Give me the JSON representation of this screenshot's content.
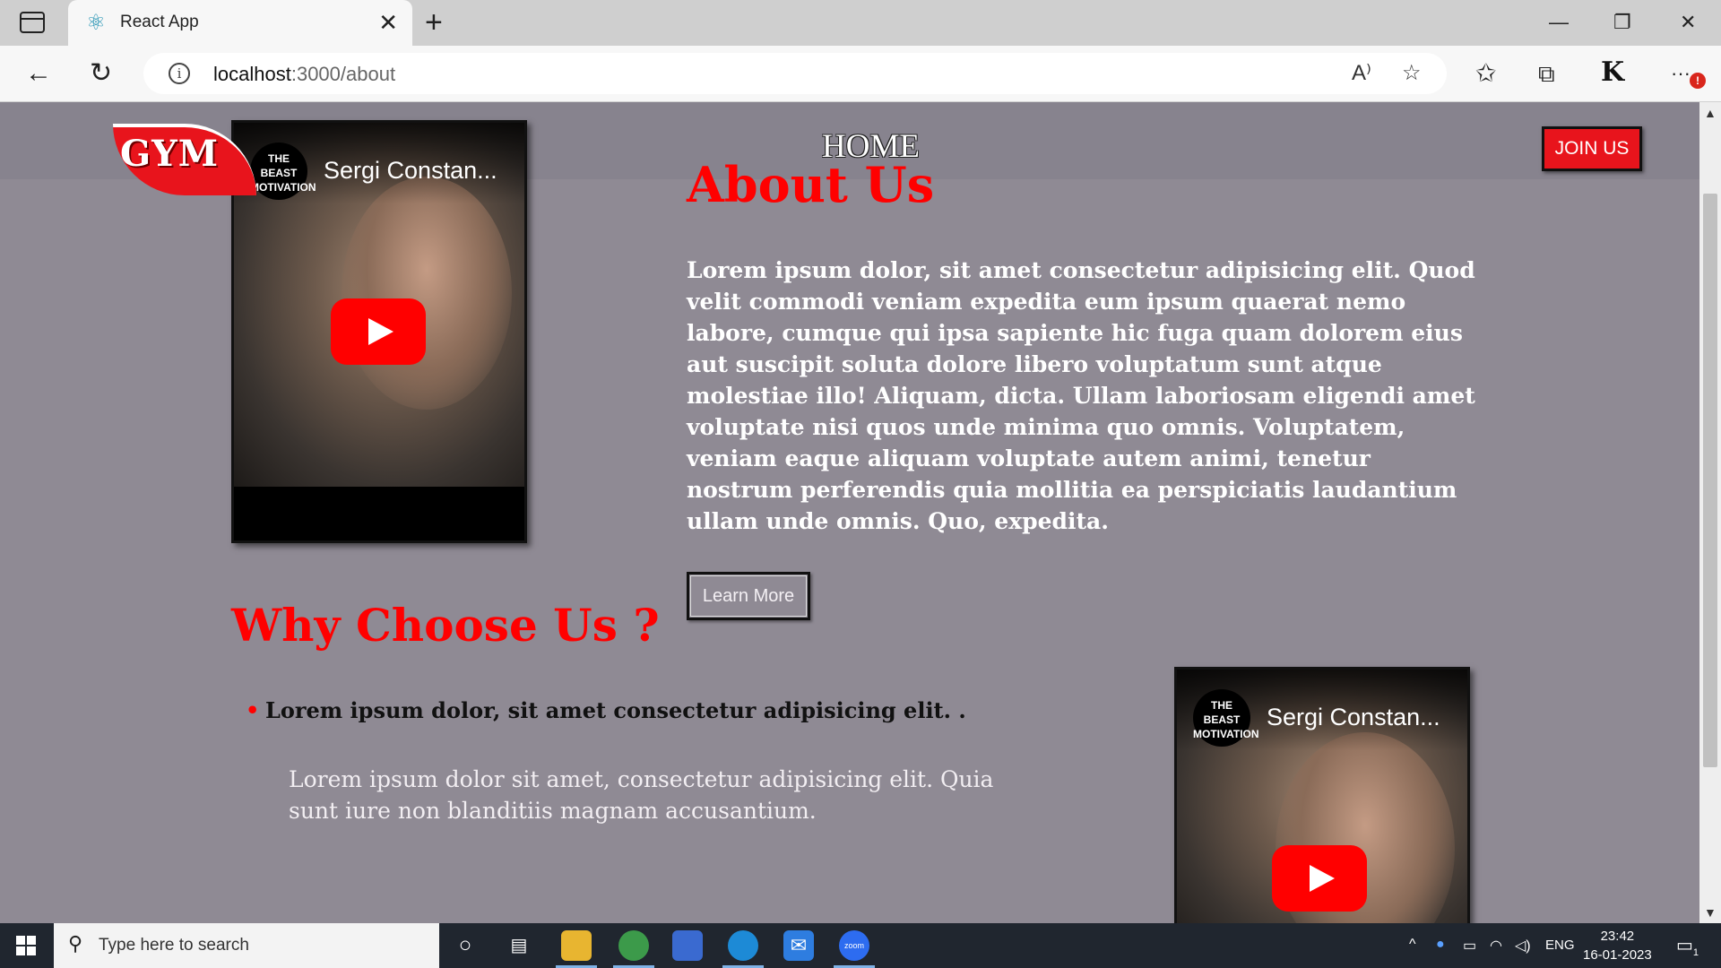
{
  "browser": {
    "tab_title": "React App",
    "url_host": "localhost",
    "url_path": ":3000/about",
    "profile_initials": "K",
    "menu_badge": "!",
    "icons": {
      "tab_actions": "tab-actions-icon",
      "favicon": "react-icon",
      "close": "close-icon",
      "new_tab": "plus-icon",
      "back": "back-arrow-icon",
      "refresh": "refresh-icon",
      "info": "info-icon",
      "read_aloud": "read-aloud-icon",
      "add_favorite": "add-favorite-icon",
      "favorites": "favorites-icon",
      "collections": "collections-icon",
      "more": "more-icon"
    },
    "glyphs": {
      "favicon": "⚛",
      "close": "✕",
      "new_tab": "+",
      "minimize": "—",
      "maximize": "❐",
      "win_close": "✕",
      "back": "←",
      "refresh": "↻",
      "info": "i",
      "read_aloud": "A⁾",
      "add_favorite": "☆",
      "favorites": "✩",
      "collections": "⧉",
      "more": "···"
    }
  },
  "site": {
    "logo_text": "GYM",
    "nav_home": "HOME",
    "join_button": "JOIN US",
    "video_channel": "THE BEAST MOTIVATION",
    "video_title": "Sergi Constan...",
    "about": {
      "title": "About Us",
      "body": "Lorem ipsum dolor, sit amet consectetur adipisicing elit. Quod velit commodi veniam expedita eum ipsum quaerat nemo labore, cumque qui ipsa sapiente hic fuga quam dolorem eius aut suscipit soluta dolore libero voluptatum sunt atque molestiae illo! Aliquam, dicta. Ullam laboriosam eligendi amet voluptate nisi quos unde minima quo omnis. Voluptatem, veniam eaque aliquam voluptate autem animi, tenetur nostrum perferendis quia mollitia ea perspiciatis laudantium ullam unde omnis. Quo, expedita.",
      "button": "Learn More"
    },
    "why": {
      "title": "Why Choose Us ?",
      "bullet": "Lorem ipsum dolor, sit amet consectetur adipisicing elit. .",
      "paragraph": "Lorem ipsum dolor sit amet, consectetur adipisicing elit. Quia sunt iure non blanditiis magnam accusantium."
    },
    "colors": {
      "background": "#8f8a94",
      "accent": "#ff0000",
      "text_light": "#ffffff"
    }
  },
  "taskbar": {
    "search_placeholder": "Type here to search",
    "language": "ENG",
    "time": "23:42",
    "date": "16-01-2023",
    "notification_count": "1",
    "zoom_label": "zoom"
  }
}
